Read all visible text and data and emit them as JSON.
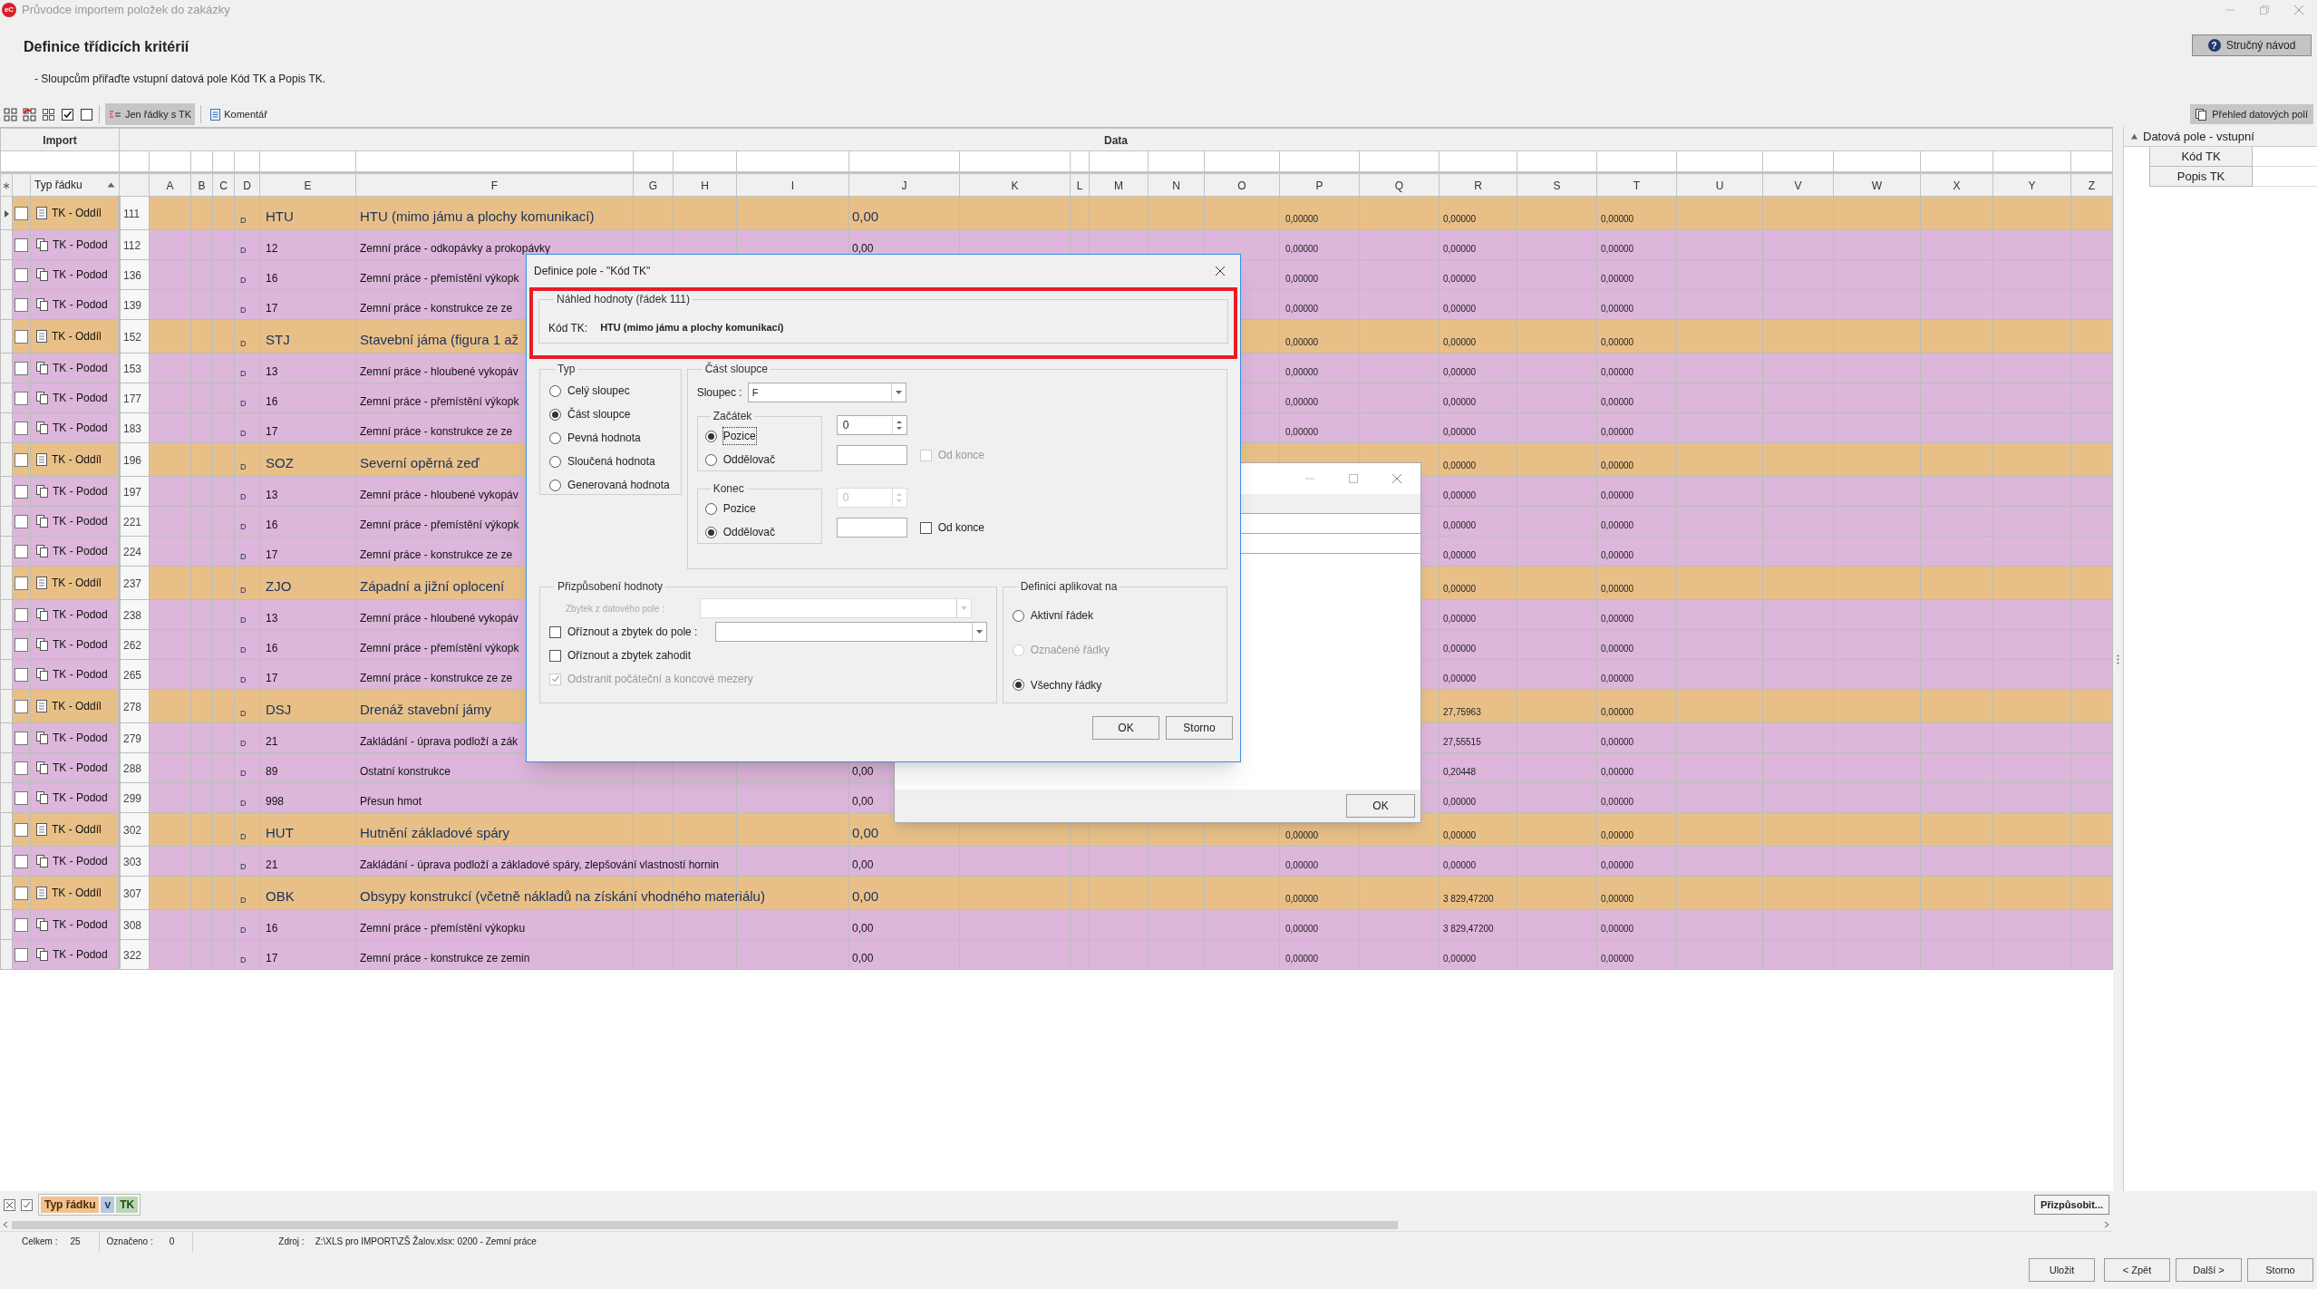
{
  "window": {
    "logo": "eC",
    "title": "Průvodce importem položek do zakázky"
  },
  "header": {
    "title": "Definice třídicích kritérií",
    "instruction": "- Sloupcům přiřaďte vstupní datová pole Kód TK a Popis TK.",
    "help_icon": "?",
    "help_button": "Stručný návod"
  },
  "toolbar": {
    "buttons": [
      {
        "label": "Jen řádky s TK",
        "selected": true,
        "kind": "filter"
      },
      {
        "label": "Komentář",
        "selected": false,
        "kind": "comment"
      }
    ],
    "overview_button": "Přehled datových polí"
  },
  "grid": {
    "bands": [
      "Import",
      "Data"
    ],
    "columns": [
      "Typ řádku",
      "A",
      "B",
      "C",
      "D",
      "E",
      "F",
      "G",
      "H",
      "I",
      "J",
      "K",
      "L",
      "M",
      "N",
      "O",
      "P",
      "Q",
      "R",
      "S",
      "T",
      "U",
      "V",
      "W",
      "X",
      "Y",
      "Z"
    ],
    "rows": [
      {
        "kind": "section",
        "selected": true,
        "checked": false,
        "type": "TK - Oddíl",
        "number": "111",
        "flag": "D",
        "code": "HTU",
        "description": "HTU (mimo jámu a plochy komunikací)",
        "col_j": "0,00",
        "col_p": "0,00000",
        "col_r": "0,00000",
        "col_t": "0,00000"
      },
      {
        "kind": "subsection",
        "selected": false,
        "checked": false,
        "type": "TK - Podod",
        "number": "112",
        "flag": "D",
        "code": "12",
        "description": "Zemní práce - odkopávky a prokopávky",
        "col_j": "0,00",
        "col_p": "0,00000",
        "col_r": "0,00000",
        "col_t": "0,00000"
      },
      {
        "kind": "subsection",
        "selected": false,
        "checked": false,
        "type": "TK - Podod",
        "number": "136",
        "flag": "D",
        "code": "16",
        "description": "Zemní práce - přemístění výkopk",
        "col_p": "0,00000",
        "col_r": "0,00000",
        "col_t": "0,00000"
      },
      {
        "kind": "subsection",
        "selected": false,
        "checked": false,
        "type": "TK - Podod",
        "number": "139",
        "flag": "D",
        "code": "17",
        "description": "Zemní práce - konstrukce ze ze",
        "col_p": "0,00000",
        "col_r": "0,00000",
        "col_t": "0,00000"
      },
      {
        "kind": "section",
        "selected": false,
        "checked": false,
        "type": "TK - Oddíl",
        "number": "152",
        "flag": "D",
        "code": "STJ",
        "description": "Stavební jáma (figura 1 až",
        "col_p": "0,00000",
        "col_r": "0,00000",
        "col_t": "0,00000"
      },
      {
        "kind": "subsection",
        "selected": false,
        "checked": false,
        "type": "TK - Podod",
        "number": "153",
        "flag": "D",
        "code": "13",
        "description": "Zemní práce - hloubené vykopáv",
        "col_p": "0,00000",
        "col_r": "0,00000",
        "col_t": "0,00000"
      },
      {
        "kind": "subsection",
        "selected": false,
        "checked": false,
        "type": "TK - Podod",
        "number": "177",
        "flag": "D",
        "code": "16",
        "description": "Zemní práce - přemístění výkopk",
        "col_p": "0,00000",
        "col_r": "0,00000",
        "col_t": "0,00000"
      },
      {
        "kind": "subsection",
        "selected": false,
        "checked": false,
        "type": "TK - Podod",
        "number": "183",
        "flag": "D",
        "code": "17",
        "description": "Zemní práce - konstrukce ze ze",
        "col_p": "0,00000",
        "col_r": "0,00000",
        "col_t": "0,00000"
      },
      {
        "kind": "section",
        "selected": false,
        "checked": false,
        "type": "TK - Oddíl",
        "number": "196",
        "flag": "D",
        "code": "SOZ",
        "description": "Severní opěrná zeď",
        "col_r": "0,00000",
        "col_t": "0,00000"
      },
      {
        "kind": "subsection",
        "selected": false,
        "checked": false,
        "type": "TK - Podod",
        "number": "197",
        "flag": "D",
        "code": "13",
        "description": "Zemní práce - hloubené vykopáv",
        "col_r": "0,00000",
        "col_t": "0,00000"
      },
      {
        "kind": "subsection",
        "selected": false,
        "checked": false,
        "type": "TK - Podod",
        "number": "221",
        "flag": "D",
        "code": "16",
        "description": "Zemní práce - přemístění výkopk",
        "col_r": "0,00000",
        "col_t": "0,00000"
      },
      {
        "kind": "subsection",
        "selected": false,
        "checked": false,
        "type": "TK - Podod",
        "number": "224",
        "flag": "D",
        "code": "17",
        "description": "Zemní práce - konstrukce ze ze",
        "col_r": "0,00000",
        "col_t": "0,00000"
      },
      {
        "kind": "section",
        "selected": false,
        "checked": false,
        "type": "TK - Oddíl",
        "number": "237",
        "flag": "D",
        "code": "ZJO",
        "description": "Západní a jižní oplocení",
        "col_r": "0,00000",
        "col_t": "0,00000"
      },
      {
        "kind": "subsection",
        "selected": false,
        "checked": false,
        "type": "TK - Podod",
        "number": "238",
        "flag": "D",
        "code": "13",
        "description": "Zemní práce - hloubené vykopáv",
        "col_r": "0,00000",
        "col_t": "0,00000"
      },
      {
        "kind": "subsection",
        "selected": false,
        "checked": false,
        "type": "TK - Podod",
        "number": "262",
        "flag": "D",
        "code": "16",
        "description": "Zemní práce - přemístění výkopk",
        "col_r": "0,00000",
        "col_t": "0,00000"
      },
      {
        "kind": "subsection",
        "selected": false,
        "checked": false,
        "type": "TK - Podod",
        "number": "265",
        "flag": "D",
        "code": "17",
        "description": "Zemní práce - konstrukce ze ze",
        "col_r": "0,00000",
        "col_t": "0,00000"
      },
      {
        "kind": "section",
        "selected": false,
        "checked": false,
        "type": "TK - Oddíl",
        "number": "278",
        "flag": "D",
        "code": "DSJ",
        "description": "Drenáž stavební jámy",
        "col_r": "27,75963",
        "col_t": "0,00000"
      },
      {
        "kind": "subsection",
        "selected": false,
        "checked": false,
        "type": "TK - Podod",
        "number": "279",
        "flag": "D",
        "code": "21",
        "description": "Zakládání - úprava podloží a zák",
        "col_r": "27,55515",
        "col_t": "0,00000"
      },
      {
        "kind": "subsection",
        "selected": false,
        "checked": false,
        "type": "TK - Podod",
        "number": "288",
        "flag": "D",
        "code": "89",
        "description": "Ostatní konstrukce",
        "col_j": "0,00",
        "col_r": "0,20448",
        "col_t": "0,00000"
      },
      {
        "kind": "subsection",
        "selected": false,
        "checked": false,
        "type": "TK - Podod",
        "number": "299",
        "flag": "D",
        "code": "998",
        "description": "Přesun hmot",
        "col_j": "0,00",
        "col_r": "0,00000",
        "col_t": "0,00000"
      },
      {
        "kind": "section",
        "selected": false,
        "checked": false,
        "type": "TK - Oddíl",
        "number": "302",
        "flag": "D",
        "code": "HUT",
        "description": "Hutnění základové spáry",
        "col_j": "0,00",
        "col_p": "0,00000",
        "col_r": "0,00000",
        "col_t": "0,00000"
      },
      {
        "kind": "subsection",
        "selected": false,
        "checked": false,
        "type": "TK - Podod",
        "number": "303",
        "flag": "D",
        "code": "21",
        "description": "Zakládání - úprava podloží a základové spáry, zlepšování vlastností hornin",
        "col_j": "0,00",
        "col_p": "0,00000",
        "col_r": "0,00000",
        "col_t": "0,00000"
      },
      {
        "kind": "section",
        "selected": false,
        "checked": false,
        "type": "TK - Oddíl",
        "number": "307",
        "flag": "D",
        "code": "OBK",
        "description": "Obsypy konstrukcí (včetně nákladů na získání vhodného materiálu)",
        "col_j": "0,00",
        "col_p": "0,00000",
        "col_r": "3 829,47200",
        "col_t": "0,00000"
      },
      {
        "kind": "subsection",
        "selected": false,
        "checked": false,
        "type": "TK - Podod",
        "number": "308",
        "flag": "D",
        "code": "16",
        "description": "Zemní práce - přemístění výkopku",
        "col_j": "0,00",
        "col_p": "0,00000",
        "col_r": "3 829,47200",
        "col_t": "0,00000"
      },
      {
        "kind": "subsection",
        "selected": false,
        "checked": false,
        "type": "TK - Podod",
        "number": "322",
        "flag": "D",
        "code": "17",
        "description": "Zemní práce - konstrukce ze zemin",
        "col_j": "0,00",
        "col_p": "0,00000",
        "col_r": "0,00000",
        "col_t": "0,00000"
      }
    ]
  },
  "side_panel": {
    "group": "Datová pole - vstupní",
    "expanded": true,
    "fields": [
      "Kód TK",
      "Popis TK"
    ]
  },
  "filter_bar": {
    "tokens": [
      {
        "text": "Typ řádku",
        "kind": "field"
      },
      {
        "text": "v",
        "kind": "operator"
      },
      {
        "text": "TK",
        "kind": "value"
      }
    ],
    "customize_button": "Přizpůsobit..."
  },
  "status_bar": {
    "total_label": "Celkem :",
    "total": "25",
    "marked_label": "Označeno :",
    "marked": "0",
    "source_label": "Zdroj :",
    "source": "Z:\\XLS pro IMPORT\\ZŠ Žalov.xlsx: 0200 - Zemní práce"
  },
  "footer_buttons": [
    "Uložit",
    "< Zpět",
    "Další >",
    "Storno"
  ],
  "back_dialog": {
    "ok_button": "OK"
  },
  "dialog": {
    "title": "Definice pole - \"Kód TK\"",
    "preview": {
      "legend": "Náhled hodnoty (řádek 111)",
      "label": "Kód TK:",
      "value": "HTU (mimo jámu a plochy komunikací)"
    },
    "type_group": {
      "legend": "Typ",
      "options": [
        {
          "label": "Celý sloupec",
          "selected": false
        },
        {
          "label": "Část sloupce",
          "selected": true
        },
        {
          "label": "Pevná hodnota",
          "selected": false
        },
        {
          "label": "Sloučená hodnota",
          "selected": false
        },
        {
          "label": "Generovaná hodnota",
          "selected": false
        }
      ]
    },
    "part_group": {
      "legend": "Část sloupce",
      "column_label": "Sloupec :",
      "column_value": "F",
      "start": {
        "legend": "Začátek",
        "options": [
          {
            "label": "Pozice",
            "selected": true
          },
          {
            "label": "Oddělovač",
            "selected": false
          }
        ],
        "position": {
          "value": "0",
          "disabled": false
        },
        "from_end": {
          "label": "Od konce",
          "checked": false,
          "disabled": true
        }
      },
      "end": {
        "legend": "Konec",
        "options": [
          {
            "label": "Pozice",
            "selected": false
          },
          {
            "label": "Oddělovač",
            "selected": true
          }
        ],
        "position": {
          "value": "0",
          "disabled": true
        },
        "from_end": {
          "label": "Od konce",
          "checked": false,
          "disabled": false
        }
      }
    },
    "adjust_group": {
      "legend": "Přizpůsobení hodnoty",
      "remainder_label": "Zbytek z datového pole :",
      "options": [
        {
          "label": "Oříznout a zbytek do pole :",
          "checked": false,
          "disabled": false,
          "kind": "dropdown"
        },
        {
          "label": "Oříznout a zbytek zahodit",
          "checked": false,
          "disabled": false,
          "kind": "plain"
        },
        {
          "label": "Odstranit počáteční a koncové mezery",
          "checked": true,
          "disabled": true,
          "kind": "plain"
        }
      ]
    },
    "apply_group": {
      "legend": "Definici aplikovat na",
      "options": [
        {
          "label": "Aktivní řádek",
          "selected": false,
          "disabled": false
        },
        {
          "label": "Označené řádky",
          "selected": false,
          "disabled": true
        },
        {
          "label": "Všechny řádky",
          "selected": true,
          "disabled": false
        }
      ]
    },
    "buttons": [
      "OK",
      "Storno"
    ]
  }
}
